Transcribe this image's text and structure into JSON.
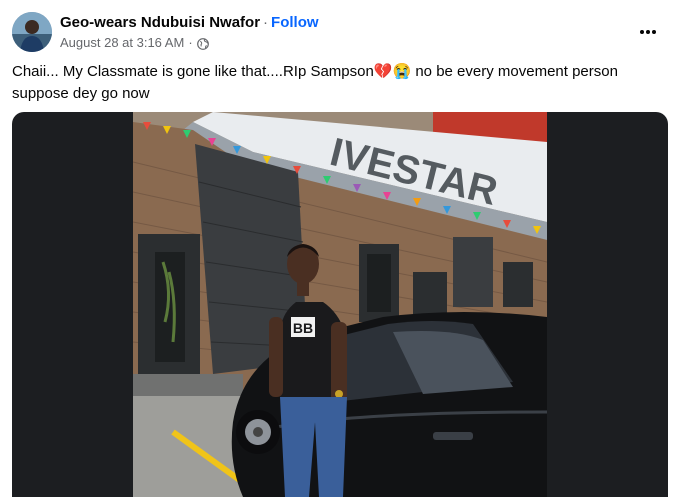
{
  "post": {
    "author": "Geo-wears Ndubuisi Nwafor",
    "separator": "·",
    "follow_label": "Follow",
    "timestamp": "August 28 at 3:16 AM",
    "sub_separator": "·",
    "audience_icon": "globe-icon",
    "more_icon": "more-options-icon",
    "caption": "Chaii... My Classmate is gone like that....RIp Sampson💔😭 no be every movement person suppose dey go now"
  },
  "photo": {
    "sign_text": "IVESTAR",
    "shirt_logo": "BB"
  },
  "colors": {
    "follow": "#0866ff",
    "secondary_text": "#65676b",
    "media_background": "#1c1e21"
  }
}
